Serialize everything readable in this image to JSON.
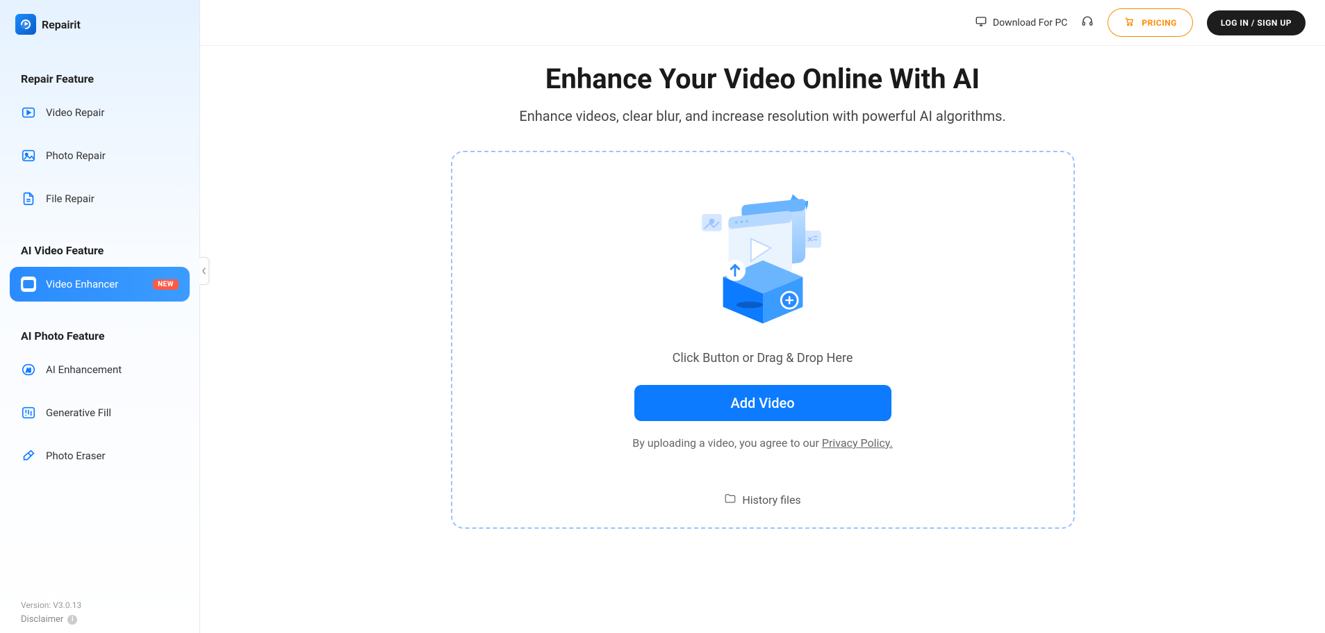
{
  "brand": {
    "name": "Repairit"
  },
  "sidebar": {
    "sections": [
      {
        "title": "Repair Feature",
        "items": [
          {
            "label": "Video Repair",
            "icon": "video-play-icon"
          },
          {
            "label": "Photo Repair",
            "icon": "photo-icon"
          },
          {
            "label": "File Repair",
            "icon": "file-icon"
          }
        ]
      },
      {
        "title": "AI Video Feature",
        "items": [
          {
            "label": "Video Enhancer",
            "icon": "ai-video-icon",
            "badge": "NEW",
            "active": true
          }
        ]
      },
      {
        "title": "AI Photo Feature",
        "items": [
          {
            "label": "AI Enhancement",
            "icon": "ai-enhance-icon"
          },
          {
            "label": "Generative Fill",
            "icon": "gen-fill-icon"
          },
          {
            "label": "Photo Eraser",
            "icon": "eraser-icon"
          }
        ]
      }
    ],
    "version": "Version: V3.0.13",
    "disclaimer": "Disclaimer"
  },
  "topbar": {
    "download": "Download For PC",
    "pricing": "PRICING",
    "login": "LOG IN / SIGN UP"
  },
  "page": {
    "title": "Enhance Your Video Online With AI",
    "subtitle": "Enhance videos, clear blur, and increase resolution with powerful AI algorithms.",
    "dropzone": {
      "hint": "Click Button or Drag & Drop Here",
      "button": "Add Video",
      "agree_prefix": "By uploading a video, you agree to our ",
      "policy": "Privacy Policy.",
      "history": "History files"
    }
  }
}
